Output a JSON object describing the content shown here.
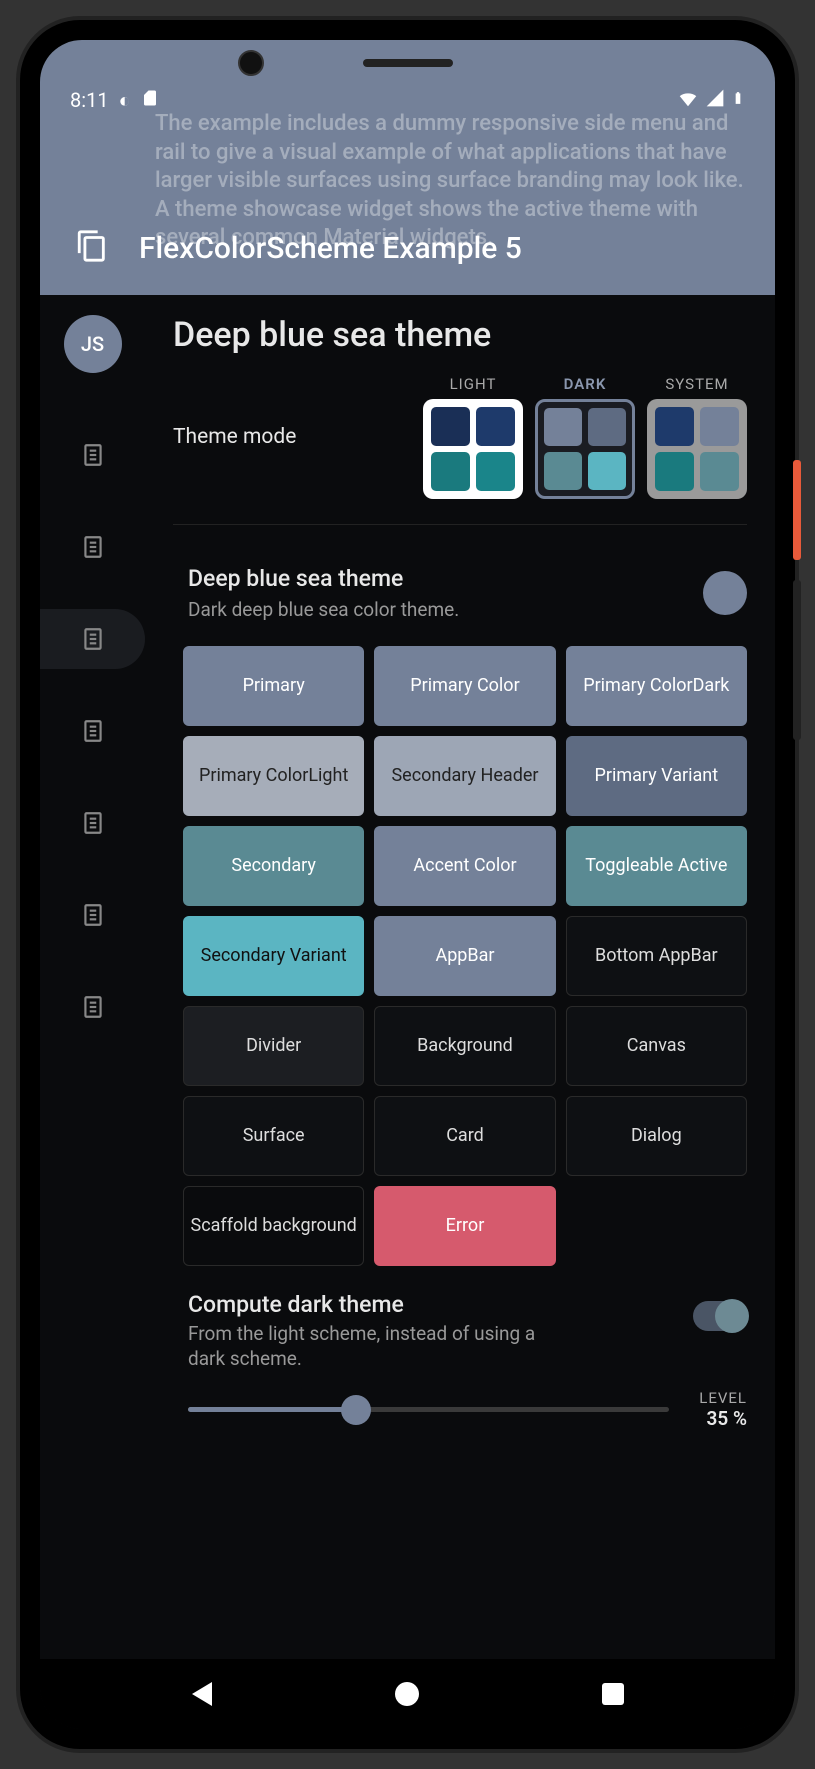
{
  "status": {
    "time": "8:11"
  },
  "appbar": {
    "bg_text": "The example includes a dummy responsive side menu and rail to give a visual example of what applications that have larger visible surfaces using surface branding may look like. A theme showcase widget shows the active theme with several common Material widgets.",
    "title": "FlexColorScheme Example 5"
  },
  "avatar": "JS",
  "page_title": "Deep blue sea theme",
  "theme_mode": {
    "label": "Theme mode",
    "options": [
      "LIGHT",
      "DARK",
      "SYSTEM"
    ],
    "selected": "DARK",
    "light_colors": [
      "#1a2f56",
      "#1e3a6b",
      "#1a7a7e",
      "#1a858a"
    ],
    "dark_colors": [
      "#748199",
      "#5e6b82",
      "#5a8a93",
      "#5bb5c2"
    ],
    "system_colors": [
      "#1e3a6b",
      "#748199",
      "#1a7a7e",
      "#5a8a93"
    ]
  },
  "theme_info": {
    "title": "Deep blue sea theme",
    "subtitle": "Dark deep blue sea color theme.",
    "dot_color": "#748199"
  },
  "tiles": [
    {
      "label": "Primary",
      "bg": "#748199",
      "fg": "#fff"
    },
    {
      "label": "Primary Color",
      "bg": "#748199",
      "fg": "#fff"
    },
    {
      "label": "Primary ColorDark",
      "bg": "#748199",
      "fg": "#fff"
    },
    {
      "label": "Primary ColorLight",
      "bg": "#a6adb9",
      "fg": "#222"
    },
    {
      "label": "Secondary Header",
      "bg": "#9da6b5",
      "fg": "#222"
    },
    {
      "label": "Primary Variant",
      "bg": "#5e6b82",
      "fg": "#fff"
    },
    {
      "label": "Secondary",
      "bg": "#5a8a93",
      "fg": "#fff"
    },
    {
      "label": "Accent Color",
      "bg": "#748199",
      "fg": "#fff"
    },
    {
      "label": "Toggleable Active",
      "bg": "#5a8a93",
      "fg": "#fff"
    },
    {
      "label": "Secondary Variant",
      "bg": "#5bb5c2",
      "fg": "#111"
    },
    {
      "label": "AppBar",
      "bg": "#748199",
      "fg": "#fff"
    },
    {
      "label": "Bottom AppBar",
      "bg": "#0e1013",
      "fg": "#ddd",
      "border": "#2a2a2a"
    },
    {
      "label": "Divider",
      "bg": "#1c1e22",
      "fg": "#ddd",
      "border": "#2a2a2a"
    },
    {
      "label": "Background",
      "bg": "#0e1013",
      "fg": "#ddd",
      "border": "#2a2a2a"
    },
    {
      "label": "Canvas",
      "bg": "#0e1013",
      "fg": "#ddd",
      "border": "#2a2a2a"
    },
    {
      "label": "Surface",
      "bg": "#0e1013",
      "fg": "#ddd",
      "border": "#2a2a2a"
    },
    {
      "label": "Card",
      "bg": "#0e1013",
      "fg": "#ddd",
      "border": "#2a2a2a"
    },
    {
      "label": "Dialog",
      "bg": "#0e1013",
      "fg": "#ddd",
      "border": "#2a2a2a"
    },
    {
      "label": "Scaffold background",
      "bg": "#0a0b0d",
      "fg": "#ddd",
      "border": "#2a2a2a"
    },
    {
      "label": "Error",
      "bg": "#d65a6d",
      "fg": "#fff"
    }
  ],
  "compute": {
    "title": "Compute dark theme",
    "subtitle": "From the light scheme, instead of using a dark scheme.",
    "enabled": true
  },
  "level": {
    "label": "LEVEL",
    "value": "35 %",
    "percent": 35
  }
}
